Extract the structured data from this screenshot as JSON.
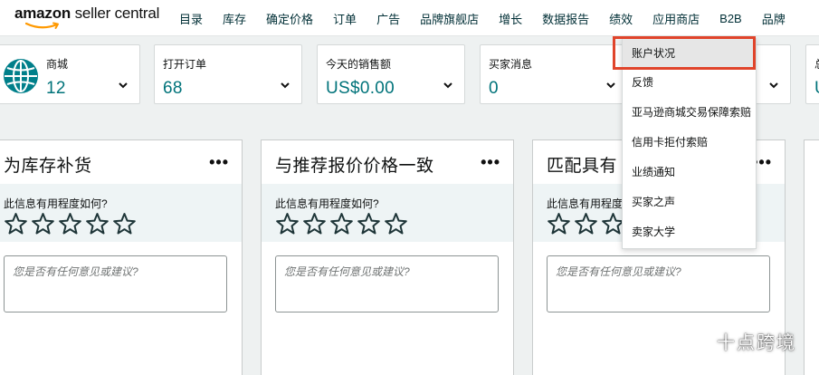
{
  "app": {
    "logo_text_bold": "amazon",
    "logo_text_rest": " seller central"
  },
  "nav": {
    "items": [
      {
        "label": "目录"
      },
      {
        "label": "库存"
      },
      {
        "label": "确定价格"
      },
      {
        "label": "订单"
      },
      {
        "label": "广告"
      },
      {
        "label": "品牌旗舰店"
      },
      {
        "label": "增长"
      },
      {
        "label": "数据报告"
      },
      {
        "label": "绩效"
      },
      {
        "label": "应用商店"
      },
      {
        "label": "B2B"
      },
      {
        "label": "品牌"
      }
    ],
    "active": "绩效"
  },
  "metrics": [
    {
      "label": "商城",
      "value": "12",
      "icon": "globe-icon"
    },
    {
      "label": "打开订单",
      "value": "68"
    },
    {
      "label": "今天的销售额",
      "value": "US$0.00"
    },
    {
      "label": "买家消息",
      "value": "0"
    },
    {
      "label": "",
      "value": ""
    },
    {
      "label": "总",
      "value": "U"
    }
  ],
  "cards": [
    {
      "title": "为库存补货",
      "more": "•••",
      "question": "此信息有用程度如何?",
      "feedback_placeholder": "您是否有任何意见或建议?"
    },
    {
      "title": "与推荐报价价格一致",
      "more": "•••",
      "question": "此信息有用程度如何?",
      "feedback_placeholder": "您是否有任何意见或建议?"
    },
    {
      "title": "匹配具有",
      "more": "•••",
      "question": "此信息有用程度如何?",
      "feedback_placeholder": "您是否有任何意见或建议?"
    }
  ],
  "rating": {
    "max": 5,
    "value": 0
  },
  "dropdown": {
    "items": [
      {
        "label": "账户状况"
      },
      {
        "label": "反馈"
      },
      {
        "label": "亚马逊商城交易保障索赔"
      },
      {
        "label": "信用卡拒付索赔"
      },
      {
        "label": "业绩通知"
      },
      {
        "label": "买家之声"
      },
      {
        "label": "卖家大学"
      }
    ],
    "selected": "账户状况"
  },
  "watermark": {
    "text": "十点跨境",
    "icon": "wechat-icon"
  },
  "colors": {
    "accent_teal": "#00737a",
    "highlight_red": "#e0442b",
    "globe_teal": "#007f8a",
    "logo_orange": "#ff9900"
  }
}
